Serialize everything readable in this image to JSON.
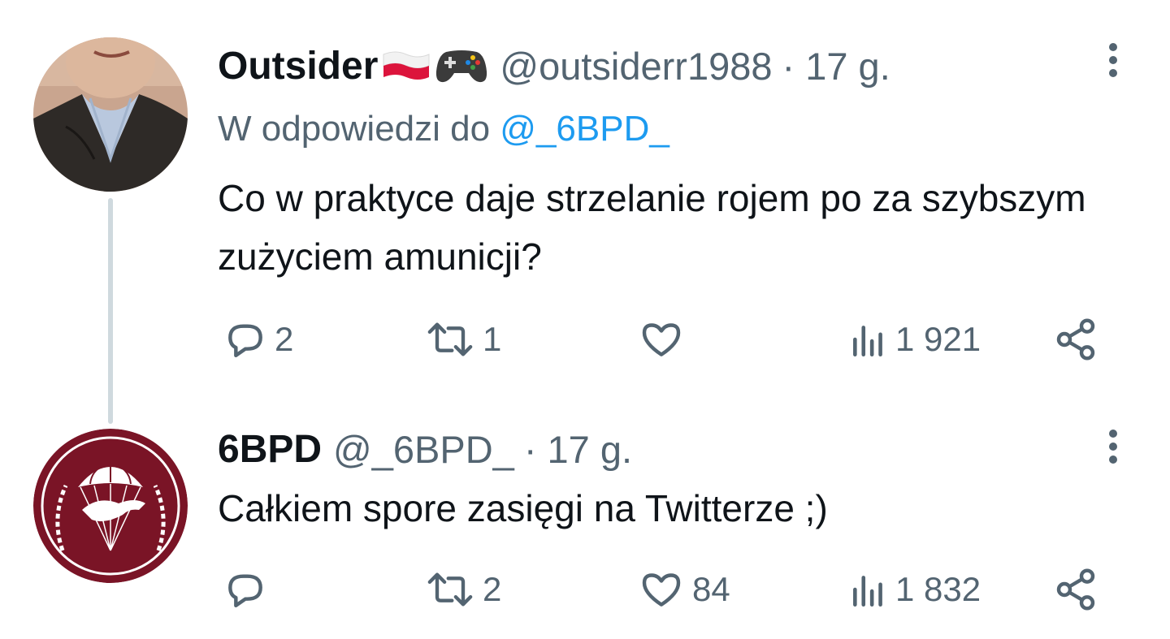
{
  "tweets": [
    {
      "name": "Outsider",
      "handle": "@outsiderr1988",
      "time": "· 17 g.",
      "reply_prefix": "W odpowiedzi do ",
      "reply_mention": "@_6BPD_",
      "text": "Co w praktyce daje strzelanie rojem po za szybszym zużyciem amunicji?",
      "replies": "2",
      "retweets": "1",
      "likes": "",
      "views": "1 921",
      "name_emoji": [
        "flag-poland-icon",
        "game-controller-icon"
      ]
    },
    {
      "name": "6BPD",
      "handle": "@_6BPD_",
      "time": "· 17 g.",
      "text": "Całkiem spore zasięgi na Twitterze ;)",
      "replies": "",
      "retweets": "2",
      "likes": "84",
      "views": "1 832"
    }
  ],
  "colors": {
    "text_primary": "#0f1419",
    "text_secondary": "#536471",
    "mention": "#1d9bf0",
    "thread_line": "#cfd9de",
    "badge_maroon": "#7a1426"
  }
}
